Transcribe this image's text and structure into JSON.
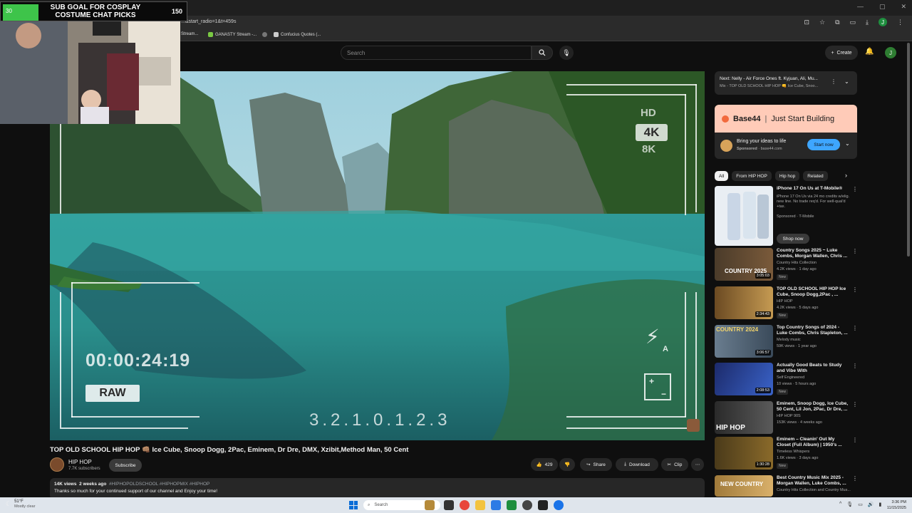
{
  "browser": {
    "url": "...&start_radio=1&t=459s",
    "bookmarks": [
      "Stream...",
      "GANASTY Stream -...",
      "Confucius Quotes (..."
    ],
    "profile_initial": "J"
  },
  "youtube": {
    "search_placeholder": "Search",
    "create_label": "Create",
    "user_initial": "J"
  },
  "stream_overlay": {
    "goal_title": "SUB GOAL FOR COSPLAY COSTUME CHAT PICKS",
    "goal_current": "30",
    "goal_target": "150"
  },
  "player": {
    "timecode": "00:00:24:19",
    "raw": "RAW",
    "scale": "3.2.1.0.1.2.3",
    "hd": "HD",
    "k4": "4K",
    "k8": "8K",
    "flash": "A"
  },
  "video": {
    "title": "TOP OLD SCHOOL HIP HOP 👊🏽 Ice Cube, Snoop Dogg, 2Pac, Eminem, Dr Dre, DMX, Xzibit,Method Man, 50 Cent",
    "channel": "HIP HOP",
    "subscribers": "7.7K subscribers",
    "subscribe_label": "Subscribe",
    "likes": "429",
    "share_label": "Share",
    "download_label": "Download",
    "clip_label": "Clip",
    "views": "14K views",
    "age": "2 weeks ago",
    "tags": "#HIPHOPOLDSCHOOL #HIPHOPMIX #HIPHOP",
    "description": "Thanks so much for your continued support of our channel and Enjoy your time!"
  },
  "up_next": {
    "title": "Next: Nelly - Air Force Ones ft. Kyjuan, Ali, Mu...",
    "subtitle": "Mix - TOP OLD SCHOOL HIP HOP 👊 Ice Cube, Snoo..."
  },
  "ad": {
    "brand": "Base44",
    "tagline": "Just Start Building",
    "line": "Bring your ideas to life",
    "sponsored": "Sponsored",
    "domain": "base44.com",
    "cta": "Start now"
  },
  "chips": [
    "All",
    "From HIP HOP",
    "Hip hop",
    "Related"
  ],
  "recommendations": [
    {
      "title": "iPhone 17 On Us at T-Mobile®",
      "channel": "iPhone 17 On Us via 24 mo credits w/elig. new line. No trade req'd. For well-qual'd +tax.",
      "stats": "Sponsored · T-Mobile",
      "cta": "Shop now",
      "duration": "",
      "new": ""
    },
    {
      "title": "Country Songs 2025 ~ Luke Combs, Morgan Wallen, Chris ...",
      "channel": "Country Hits Collection",
      "stats": "4.2K views · 1 day ago",
      "duration": "3:05:03",
      "new": "New",
      "thumb_text": "COUNTRY 2025"
    },
    {
      "title": "TOP OLD SCHOOL HIP HOP Ice Cube, Snoop Dogg,2Pac , ...",
      "channel": "HIP HOP",
      "stats": "4.2K views · 5 days ago",
      "duration": "2:34:43",
      "new": "New",
      "thumb_text": ""
    },
    {
      "title": "Top Country Songs of 2024 - Luke Combs, Chris Stapleton, ...",
      "channel": "Melody music",
      "stats": "59K views · 1 year ago",
      "duration": "3:06:57",
      "new": "",
      "thumb_text": "COUNTRY 2024"
    },
    {
      "title": "Actually Good Beats to Study and Vibe With",
      "channel": "Self Engineered",
      "stats": "10 views · 5 hours ago",
      "duration": "2:08:53",
      "new": "New",
      "thumb_text": ""
    },
    {
      "title": "Eminem, Snoop Dogg, Ice Cube, 50 Cent, Lil Jon, 2Pac, Dr Dre, ...",
      "channel": "HIP HOP 90S",
      "stats": "153K views · 4 weeks ago",
      "duration": "",
      "new": "",
      "thumb_text": "HIP HOP"
    },
    {
      "title": "Eminem – Cleanin' Out My Closet (Full Album) | 1950's ...",
      "channel": "Timeless Whispers",
      "stats": "1.6K views · 3 days ago",
      "duration": "1:30:28",
      "new": "New",
      "thumb_text": ""
    },
    {
      "title": "Best Country Music Mix 2025 - Morgan Wallen, Luke Combs, ...",
      "channel": "Country Hits Collection and Country Mus...",
      "stats": "",
      "duration": "",
      "new": "",
      "thumb_text": "NEW COUNTRY"
    }
  ],
  "taskbar": {
    "temp": "51°F",
    "weather": "Mostly clear",
    "search": "Search",
    "time": "3:36 PM",
    "date": "11/15/2025"
  }
}
